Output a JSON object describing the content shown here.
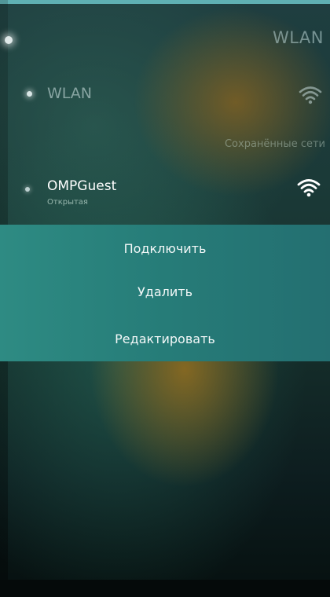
{
  "page": {
    "header": "WLAN"
  },
  "wlan_toggle": {
    "label": "WLAN",
    "icon": "wifi-icon"
  },
  "saved_networks": {
    "section_title": "Сохранённые сети",
    "items": [
      {
        "name": "OMPGuest",
        "status": "Открытая",
        "icon": "wifi-icon"
      }
    ]
  },
  "context_menu": {
    "items": [
      {
        "label": "Подключить"
      },
      {
        "label": "Удалить"
      },
      {
        "label": "Редактировать"
      }
    ]
  },
  "colors": {
    "accent": "#5fb0b3",
    "menu_background": "#2a8580"
  }
}
